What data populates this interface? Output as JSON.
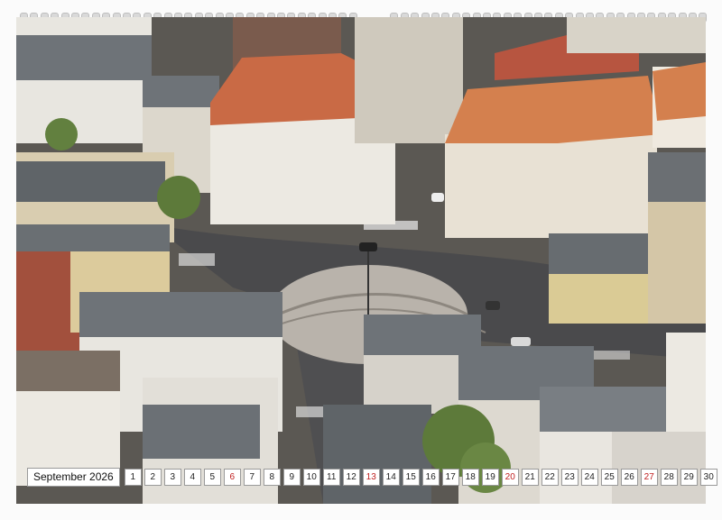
{
  "calendar": {
    "month_label": "September 2026",
    "days": [
      {
        "n": "1",
        "sun": false
      },
      {
        "n": "2",
        "sun": false
      },
      {
        "n": "3",
        "sun": false
      },
      {
        "n": "4",
        "sun": false
      },
      {
        "n": "5",
        "sun": false
      },
      {
        "n": "6",
        "sun": true
      },
      {
        "n": "7",
        "sun": false
      },
      {
        "n": "8",
        "sun": false
      },
      {
        "n": "9",
        "sun": false
      },
      {
        "n": "10",
        "sun": false
      },
      {
        "n": "11",
        "sun": false
      },
      {
        "n": "12",
        "sun": false
      },
      {
        "n": "13",
        "sun": true
      },
      {
        "n": "14",
        "sun": false
      },
      {
        "n": "15",
        "sun": false
      },
      {
        "n": "16",
        "sun": false
      },
      {
        "n": "17",
        "sun": false
      },
      {
        "n": "18",
        "sun": false
      },
      {
        "n": "19",
        "sun": false
      },
      {
        "n": "20",
        "sun": true
      },
      {
        "n": "21",
        "sun": false
      },
      {
        "n": "22",
        "sun": false
      },
      {
        "n": "23",
        "sun": false
      },
      {
        "n": "24",
        "sun": false
      },
      {
        "n": "25",
        "sun": false
      },
      {
        "n": "26",
        "sun": false
      },
      {
        "n": "27",
        "sun": true
      },
      {
        "n": "28",
        "sun": false
      },
      {
        "n": "29",
        "sun": false
      },
      {
        "n": "30",
        "sun": false
      }
    ]
  },
  "colors": {
    "sunday": "#c02020",
    "roof_red": "#c96a45",
    "roof_grey": "#6e7378",
    "road": "#4a4a4c",
    "plaza": "#b9b3ab",
    "tree": "#5d7a3a"
  }
}
